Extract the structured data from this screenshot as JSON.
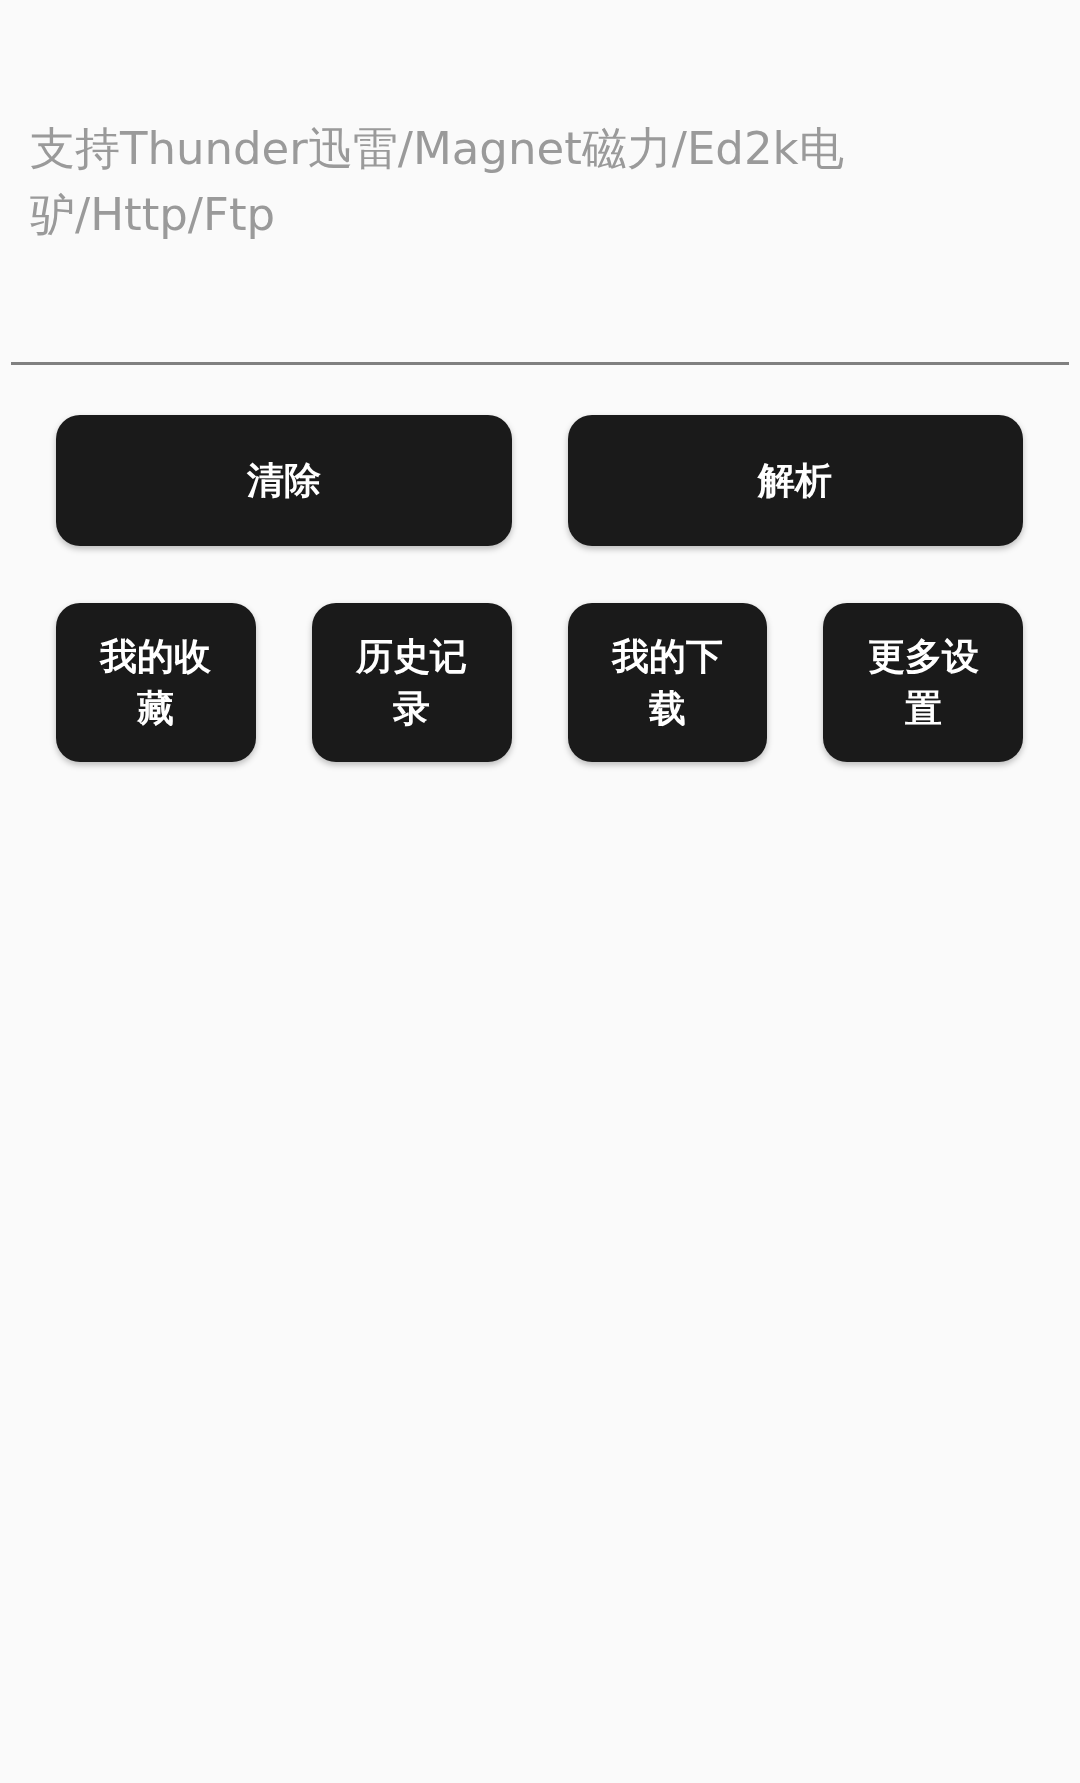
{
  "input": {
    "placeholder": "支持Thunder迅雷/Magnet磁力/Ed2k电驴/Http/Ftp"
  },
  "main_buttons": [
    {
      "label": "清除"
    },
    {
      "label": "解析"
    }
  ],
  "shortcut_buttons": [
    {
      "label": "我的收藏"
    },
    {
      "label": "历史记录"
    },
    {
      "label": "我的下载"
    },
    {
      "label": "更多设置"
    }
  ]
}
